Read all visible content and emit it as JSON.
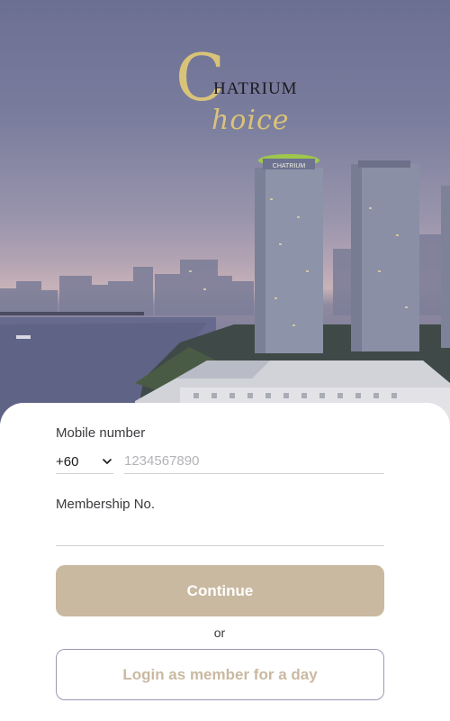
{
  "logo": {
    "initial": "C",
    "wordmark": "HATRIUM",
    "script": "hoice",
    "gold_color": "#d9c37a"
  },
  "building_sign": "CHATRIUM",
  "form": {
    "mobile_label": "Mobile number",
    "country_code": "+60",
    "country_chevron_icon": "chevron-down-icon",
    "phone_placeholder": "1234567890",
    "phone_value": "",
    "membership_label": "Membership No.",
    "membership_value": ""
  },
  "actions": {
    "continue_label": "Continue",
    "continue_color": "#c9b9a1",
    "or_label": "or",
    "member_day_label": "Login as member for a day"
  }
}
